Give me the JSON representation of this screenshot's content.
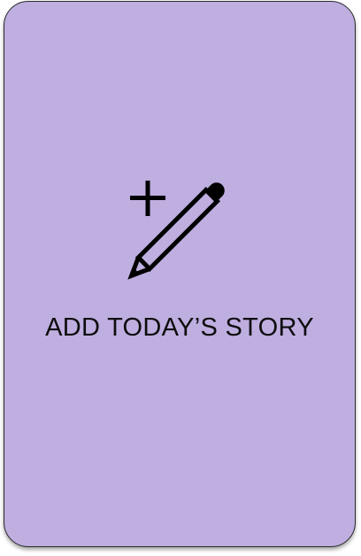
{
  "card": {
    "label": "ADD TODAY’S STORY",
    "icon": "add-edit-icon",
    "background_color": "#bfaee0"
  }
}
